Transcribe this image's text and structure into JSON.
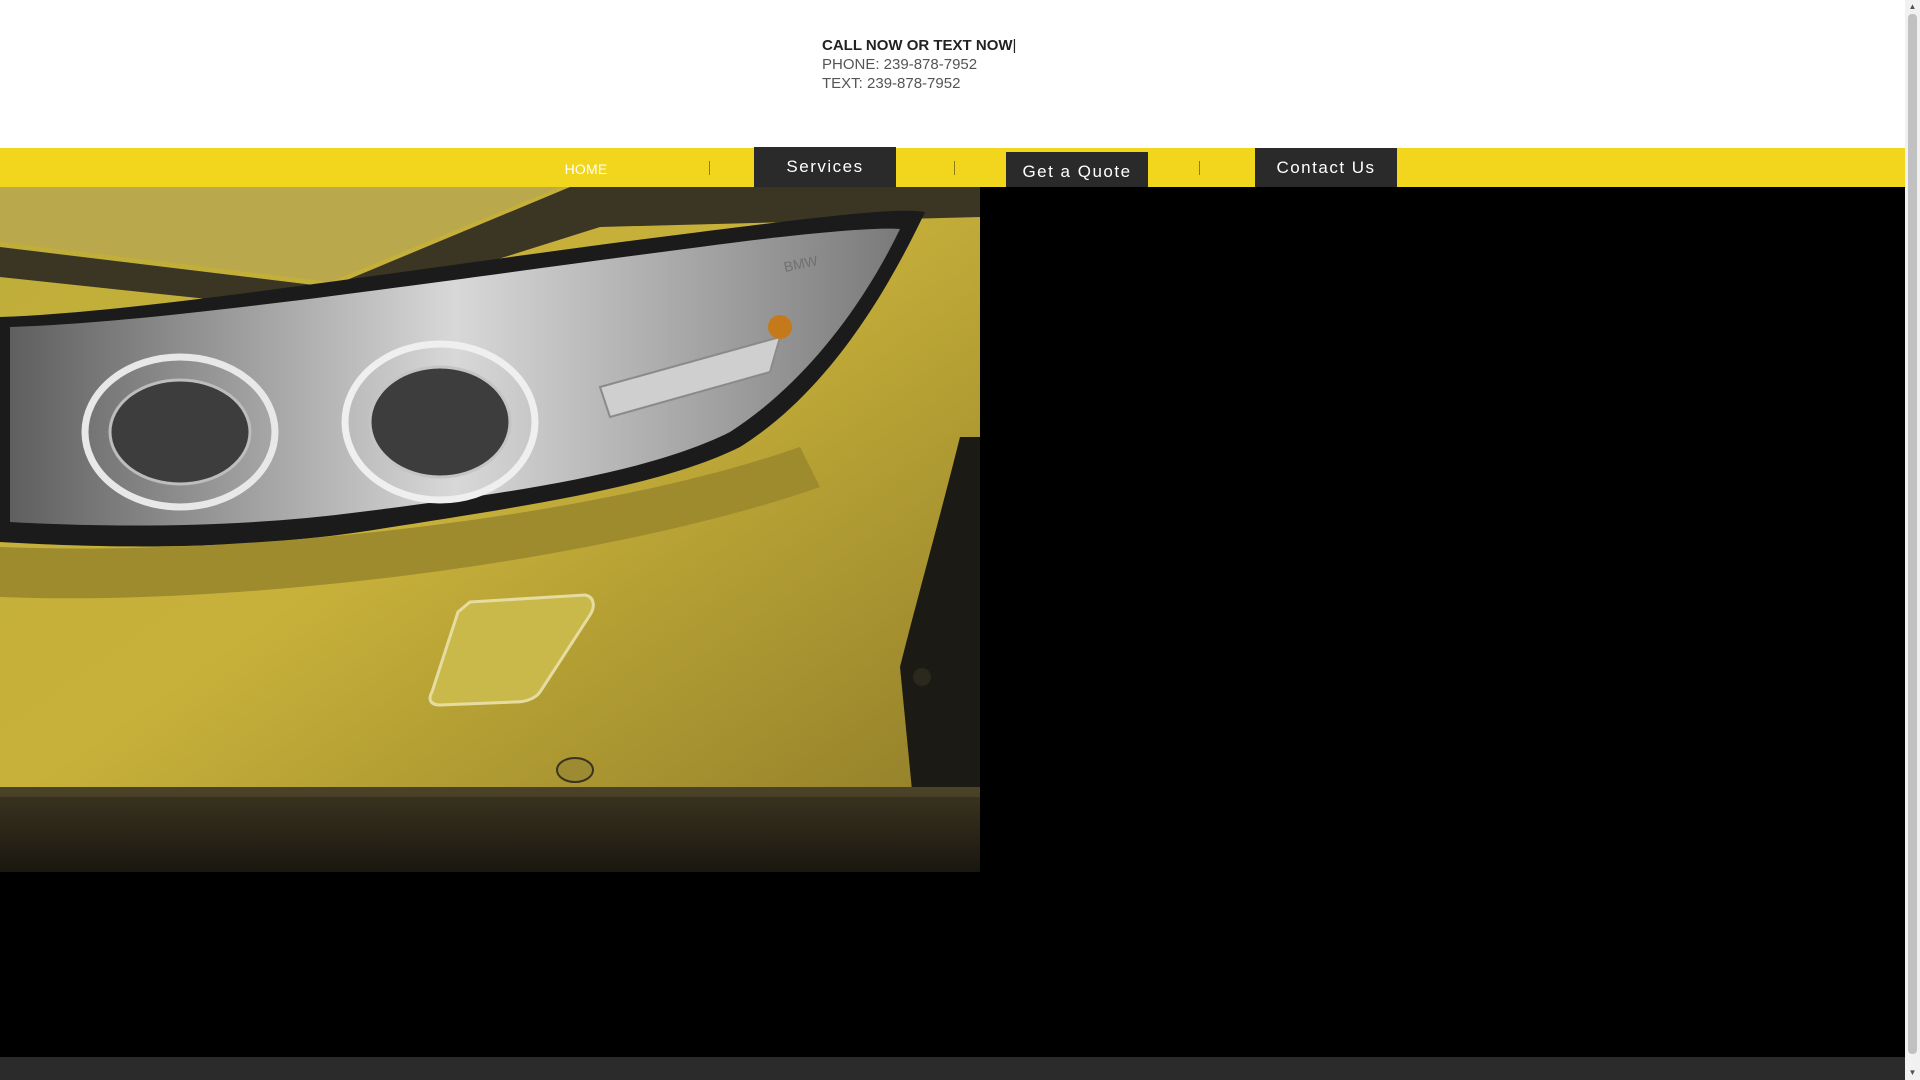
{
  "header": {
    "call_label": "CALL NOW OR TEXT NOW",
    "cursor_mark": "|",
    "phone": "PHONE: 239-878-7952",
    "text": "TEXT: 239-878-7952"
  },
  "nav": {
    "home": "HOME",
    "services": "Services",
    "quote": "Get a Quote",
    "contact": "Contact Us"
  },
  "hero": {
    "image_alt": "Close-up of a yellow car headlight with BMW badge",
    "badge_text": "BMW"
  },
  "colors": {
    "nav_yellow": "#f2d61d",
    "button_dark": "#2a2a2a",
    "hero_black": "#000000"
  }
}
